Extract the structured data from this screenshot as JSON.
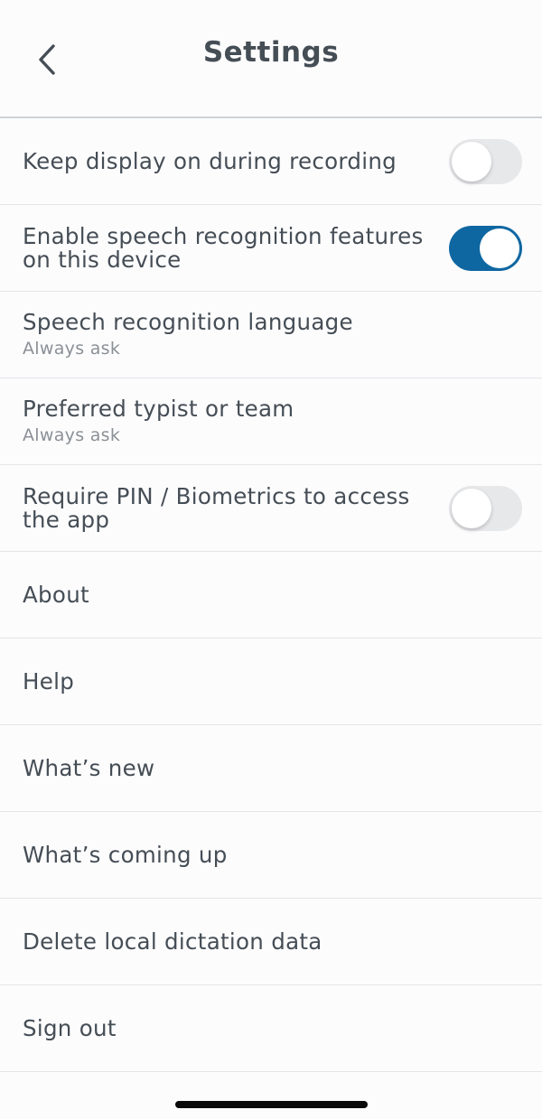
{
  "header": {
    "title": "Settings",
    "back_icon": "chevron-left-icon"
  },
  "settings": {
    "keep_display": {
      "label": "Keep display on during recording",
      "enabled": false
    },
    "speech_recognition": {
      "label": "Enable speech recognition features on this device",
      "enabled": true
    },
    "speech_language": {
      "label": "Speech recognition language",
      "value": "Always ask"
    },
    "preferred_typist": {
      "label": "Preferred typist or team",
      "value": "Always ask"
    },
    "require_pin": {
      "label": "Require PIN / Biometrics to access the app",
      "enabled": false
    },
    "about": {
      "label": "About"
    },
    "help": {
      "label": "Help"
    },
    "whats_new": {
      "label": "What’s new"
    },
    "whats_coming": {
      "label": "What’s coming up"
    },
    "delete_local": {
      "label": "Delete local dictation data"
    },
    "sign_out": {
      "label": "Sign out"
    }
  },
  "colors": {
    "toggle_on": "#0f67a1",
    "toggle_off": "#e7e8ea",
    "text_primary": "#454d55",
    "text_secondary": "#8a9096"
  }
}
